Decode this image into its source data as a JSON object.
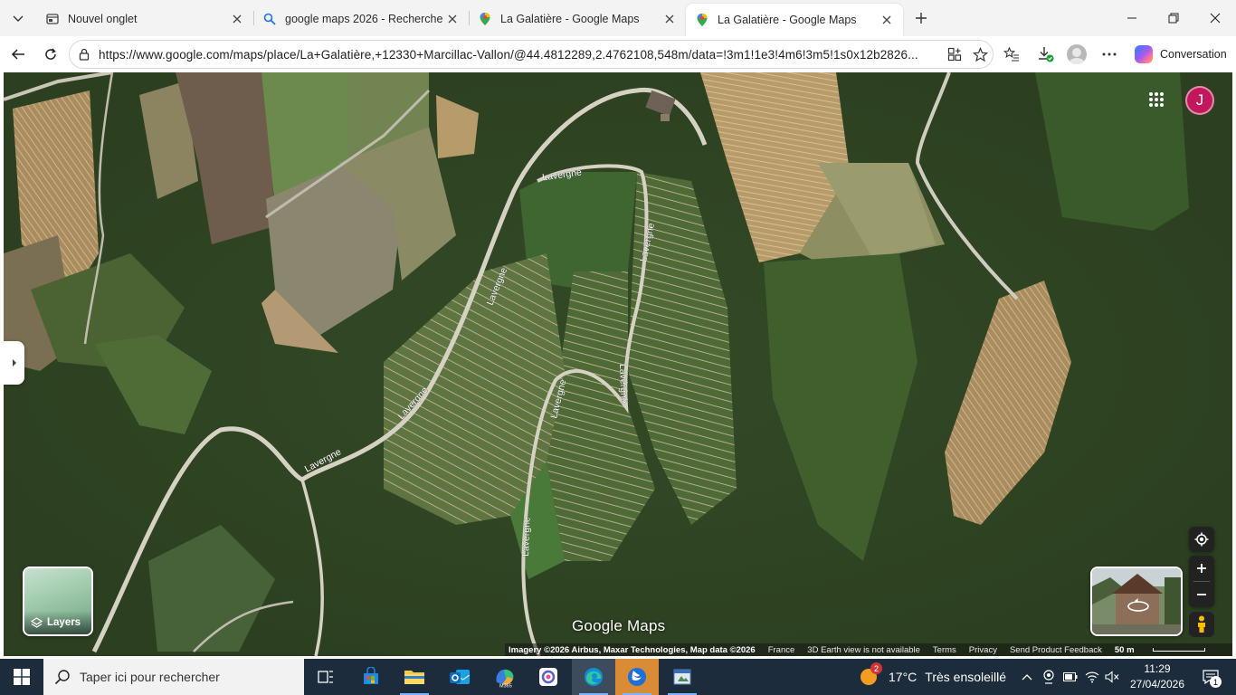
{
  "browser": {
    "tabs": [
      {
        "title": "Nouvel onglet",
        "icon": "new-tab-page-icon",
        "active": false
      },
      {
        "title": "google maps 2026 - Recherche",
        "icon": "search-icon",
        "active": false
      },
      {
        "title": "La Galatière - Google Maps",
        "icon": "maps-pin-icon",
        "active": false
      },
      {
        "title": "La Galatière - Google Maps",
        "icon": "maps-pin-icon",
        "active": true
      }
    ],
    "url": "https://www.google.com/maps/place/La+Galatière,+12330+Marcillac-Vallon/@44.4812289,2.4762108,548m/data=!3m1!1e3!4m6!3m5!1s0x12b2826...",
    "copilot_label": "Conversation",
    "download_badge_color": "#1a9f36"
  },
  "map": {
    "road_labels": [
      "Lavergne",
      "Lavergne",
      "Lavergne",
      "Lavergne",
      "Lavergne",
      "Lavergne",
      "Lavergne",
      "Lavergne"
    ],
    "account_initial": "J",
    "account_color": "#c2185b",
    "layers_label": "Layers",
    "logo_text": "Google Maps",
    "attribution": {
      "imagery": "Imagery ©2026 Airbus, Maxar Technologies, Map data ©2026",
      "country": "France",
      "earth": "3D Earth view is not available",
      "terms": "Terms",
      "privacy": "Privacy",
      "feedback": "Send Product Feedback",
      "scale": "50 m"
    }
  },
  "taskbar": {
    "search_placeholder": "Taper ici pour rechercher",
    "weather_temp": "17°C",
    "weather_desc": "Très ensoleillé",
    "weather_badge": "2",
    "time": "11:29",
    "date": "27/04/2026",
    "notification_count": "1",
    "apps": [
      "task-view-icon",
      "microsoft-store-icon",
      "file-explorer-icon",
      "outlook-icon",
      "m365-icon",
      "copilot-app-icon",
      "edge-icon",
      "swift-app-icon",
      "paint-app-icon"
    ]
  }
}
